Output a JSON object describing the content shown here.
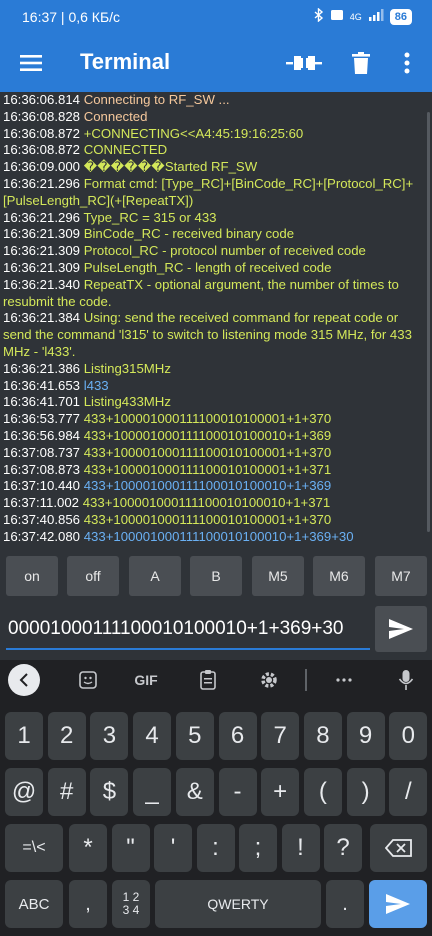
{
  "status": {
    "time": "16:37 | 0,6 КБ/с",
    "battery": "86",
    "net": "4G"
  },
  "appbar": {
    "title": "Terminal"
  },
  "terminal": {
    "lines": [
      {
        "t": "16:36:06.814",
        "m": "Connecting to RF_SW ...",
        "c": "#f5c89c"
      },
      {
        "t": "16:36:08.828",
        "m": "Connected",
        "c": "#f5c89c"
      },
      {
        "t": "16:36:08.872",
        "m": "+CONNECTING<<A4:45:19:16:25:60",
        "c": "#d4e85a"
      },
      {
        "t": "16:36:08.872",
        "m": "CONNECTED",
        "c": "#d4e85a"
      },
      {
        "t": "16:36:09.000",
        "m": "������Started RF_SW",
        "c": "#d4e85a"
      },
      {
        "t": "16:36:21.296",
        "m": "Format cmd: [Type_RC]+[BinCode_RC]+[Protocol_RC]+[PulseLength_RC](+[RepeatTX])",
        "c": "#d4e85a"
      },
      {
        "t": "16:36:21.296",
        "m": "Type_RC = 315 or 433",
        "c": "#d4e85a"
      },
      {
        "t": "16:36:21.309",
        "m": "BinCode_RC - received binary code",
        "c": "#d4e85a"
      },
      {
        "t": "16:36:21.309",
        "m": "Protocol_RC - protocol number of received code",
        "c": "#d4e85a"
      },
      {
        "t": "16:36:21.309",
        "m": "PulseLength_RC - length of received code",
        "c": "#d4e85a"
      },
      {
        "t": "16:36:21.340",
        "m": "RepeatTX - optional argument, the number of times to resubmit the code.",
        "c": "#d4e85a"
      },
      {
        "t": "16:36:21.384",
        "m": "Using: send the received command for repeat code or send the command 'l315' to switch to listening mode 315 MHz, for 433 MHz - 'l433'.",
        "c": "#d4e85a"
      },
      {
        "t": "16:36:21.386",
        "m": "Listing315MHz",
        "c": "#d4e85a"
      },
      {
        "t": "16:36:41.653",
        "m": "l433",
        "c": "#6ab0f3"
      },
      {
        "t": "16:36:41.701",
        "m": "Listing433MHz",
        "c": "#d4e85a"
      },
      {
        "t": "16:36:53.777",
        "m": "433+100001000111100010100001+1+370",
        "c": "#d4e85a"
      },
      {
        "t": "16:36:56.984",
        "m": "433+100001000111100010100010+1+369",
        "c": "#d4e85a"
      },
      {
        "t": "16:37:08.737",
        "m": "433+100001000111100010100001+1+370",
        "c": "#d4e85a"
      },
      {
        "t": "16:37:08.873",
        "m": "433+100001000111100010100001+1+371",
        "c": "#d4e85a"
      },
      {
        "t": "16:37:10.440",
        "m": "433+100001000111100010100010+1+369",
        "c": "#6ab0f3"
      },
      {
        "t": "16:37:11.002",
        "m": "433+100001000111100010100010+1+371",
        "c": "#d4e85a"
      },
      {
        "t": "16:37:40.856",
        "m": "433+100001000111100010100001+1+370",
        "c": "#d4e85a"
      },
      {
        "t": "16:37:42.080",
        "m": "433+100001000111100010100010+1+369+30",
        "c": "#6ab0f3"
      }
    ]
  },
  "macros": [
    "on",
    "off",
    "A",
    "B",
    "M5",
    "M6",
    "M7"
  ],
  "input": {
    "value": "000010001111000101000​10+1+369+30"
  },
  "keyboard": {
    "toolbar": [
      "GIF"
    ],
    "row1": [
      "1",
      "2",
      "3",
      "4",
      "5",
      "6",
      "7",
      "8",
      "9",
      "0"
    ],
    "row2": [
      "@",
      "#",
      "$",
      "_",
      "&",
      "-",
      "+",
      "(",
      ")",
      "/"
    ],
    "row3": [
      "=\\<",
      "*",
      "\"",
      "'",
      ":",
      ";",
      "!",
      "?"
    ],
    "bottom": {
      "abc": "ABC",
      "comma": ",",
      "num1": "1 2",
      "num2": "3 4",
      "space": "QWERTY",
      "dot": "."
    }
  },
  "colors": {
    "accent": "#2a7bd6",
    "timestamp": "#ffffff"
  }
}
